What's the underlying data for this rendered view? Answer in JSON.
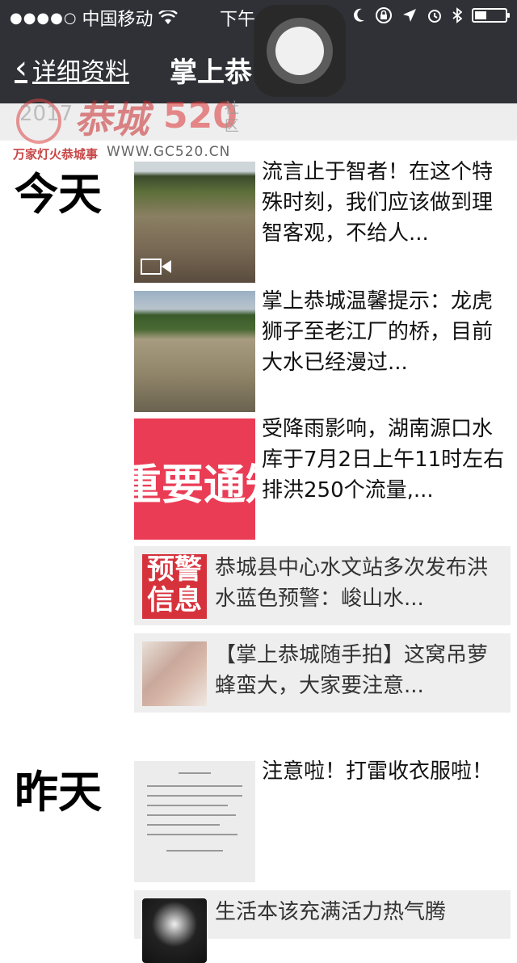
{
  "status_bar": {
    "signal_dots": "●●●●○",
    "carrier": "中国移动",
    "time": "下午",
    "battery_level": 0.4
  },
  "nav": {
    "back_label": "详细资料",
    "title": "掌上恭"
  },
  "watermark": {
    "year": "2017",
    "name": "恭城",
    "number": "520",
    "community": "社区",
    "slogan": "万家灯火恭城事",
    "url": "WWW.GC520.CN"
  },
  "sections": {
    "today": "今天",
    "yesterday": "昨天"
  },
  "articles": [
    {
      "title": "流言止于智者！在这个特殊时刻，我们应该做到理智客观，不给人..."
    },
    {
      "title": "掌上恭城温馨提示：龙虎狮子至老江厂的桥，目前大水已经漫过..."
    },
    {
      "title": "受降雨影响，湖南源口水库于7月2日上午11时左右排洪250个流量,...",
      "thumb_text": "重要通知"
    },
    {
      "title": "恭城县中心水文站多次发布洪水蓝色预警：峻山水...",
      "thumb_text_1": "预警",
      "thumb_text_2": "信息"
    },
    {
      "title": "【掌上恭城随手拍】这窝吊萝蜂蛮大，大家要注意..."
    },
    {
      "title": "注意啦！打雷收衣服啦！"
    },
    {
      "title": "生活本该充满活力热气腾"
    }
  ]
}
